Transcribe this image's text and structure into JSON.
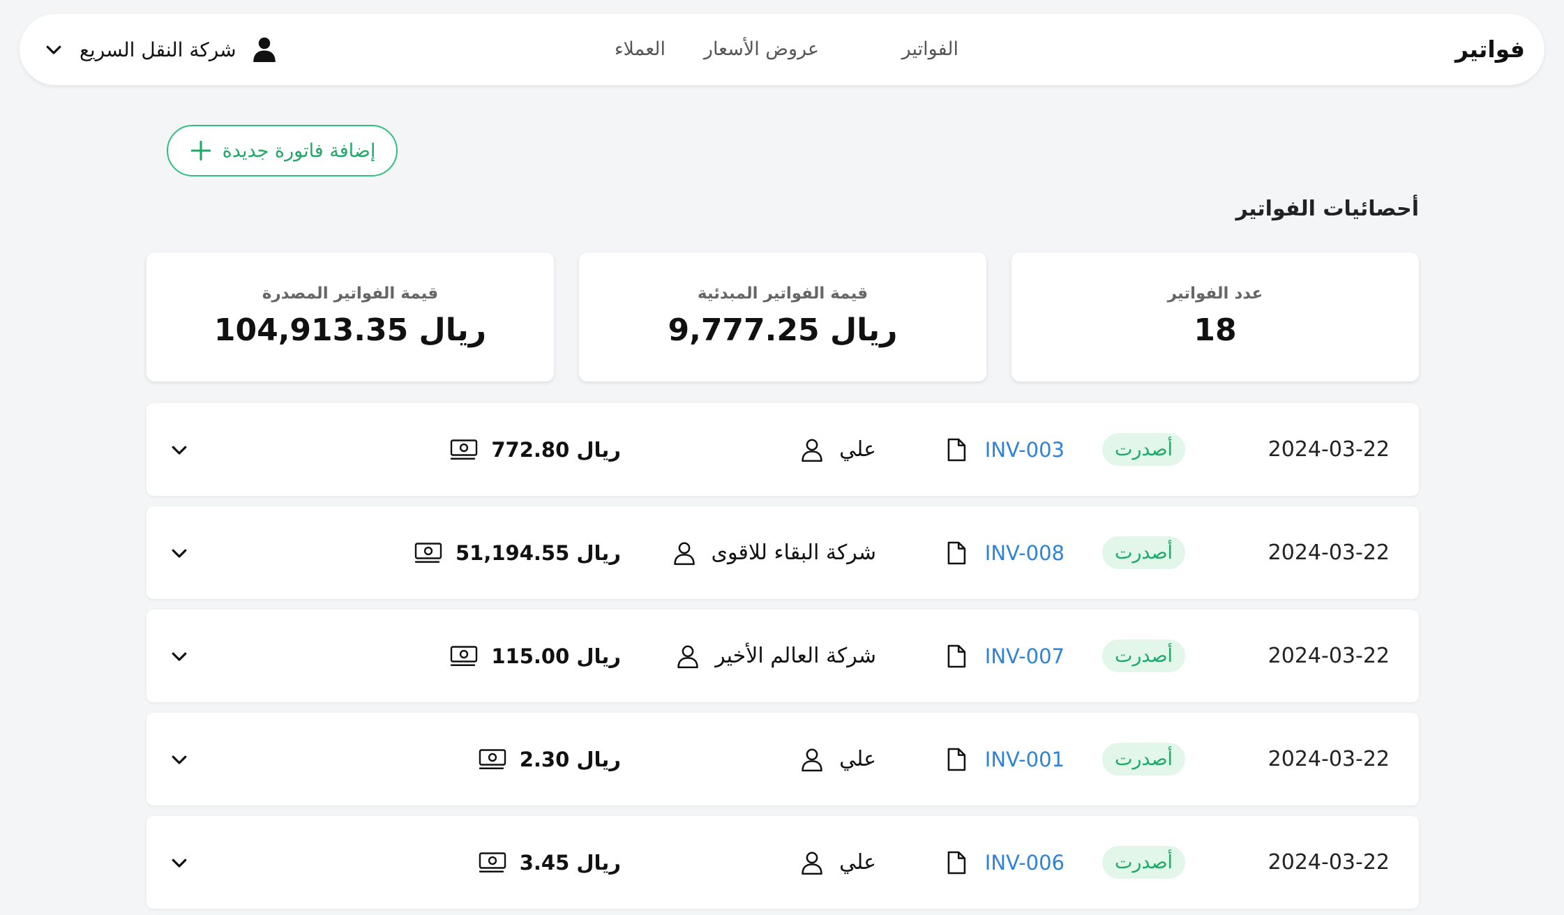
{
  "app": {
    "brand": "فواتير"
  },
  "nav": {
    "links": [
      "الفواتير",
      "عروض الأسعار",
      "العملاء"
    ],
    "company": "شركة النقل السريع"
  },
  "actions": {
    "add_invoice": "إضافة فاتورة جديدة"
  },
  "stats": {
    "title": "أحصائيات الفواتير",
    "cards": [
      {
        "label": "عدد الفواتير",
        "value": "18"
      },
      {
        "label": "قيمة الفواتير المبدئية",
        "value": "9,777.25 ريال"
      },
      {
        "label": "قيمة الفواتير المصدرة",
        "value": "104,913.35 ريال"
      }
    ]
  },
  "invoices": [
    {
      "date": "2024-03-22",
      "status": "أصدرت",
      "number": "INV-003",
      "client": "علي",
      "amount": "772.80 ريال"
    },
    {
      "date": "2024-03-22",
      "status": "أصدرت",
      "number": "INV-008",
      "client": "شركة البقاء للاقوى",
      "amount": "51,194.55 ريال"
    },
    {
      "date": "2024-03-22",
      "status": "أصدرت",
      "number": "INV-007",
      "client": "شركة العالم الأخير",
      "amount": "115.00 ريال"
    },
    {
      "date": "2024-03-22",
      "status": "أصدرت",
      "number": "INV-001",
      "client": "علي",
      "amount": "2.30 ريال"
    },
    {
      "date": "2024-03-22",
      "status": "أصدرت",
      "number": "INV-006",
      "client": "علي",
      "amount": "3.45 ريال"
    }
  ],
  "colors": {
    "accent_green": "#1fa868",
    "link_blue": "#2f83d6",
    "badge_bg": "#e3f6ea"
  },
  "icons": [
    "user-icon",
    "chevron-down-icon",
    "plus-icon",
    "document-icon",
    "user-outline-icon",
    "cash-icon"
  ]
}
